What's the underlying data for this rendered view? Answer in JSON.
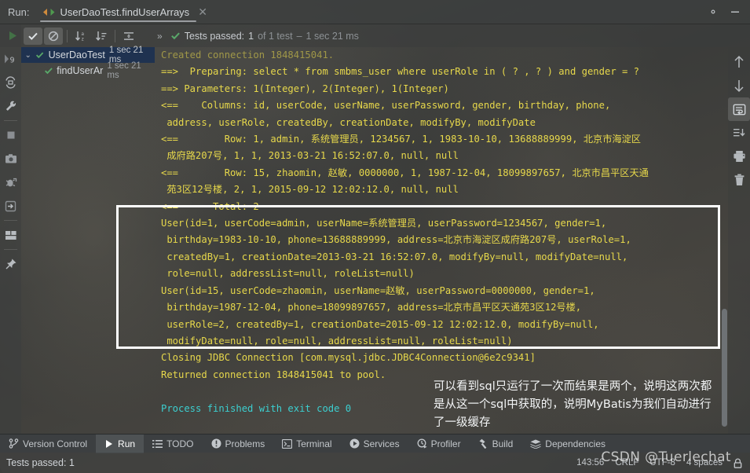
{
  "window": {
    "run_label": "Run:",
    "tab_title": "UserDaoTest.findUserArrays",
    "close_glyph": "✕",
    "settings_icon": "gear-icon",
    "minimize_icon": "minimize-icon"
  },
  "toolbar": {
    "rerun_label": "Rerun",
    "show_passed_label": "Show Passed",
    "show_ignored_label": "Show Ignored",
    "sort_alpha_label": "Sort Alphabetically",
    "sort_duration_label": "Sort by Duration",
    "expand_collapse_label": "Expand / Collapse",
    "more_glyph": "»",
    "status_prefix": "Tests passed:",
    "status_count": "1",
    "status_of": "of 1 test",
    "status_dash": "–",
    "status_time": "1 sec 21 ms"
  },
  "test_tree": {
    "rows": [
      {
        "arrow": "⌄",
        "name": "UserDaoTest",
        "time": "1 sec 21 ms",
        "selected": true,
        "indent": 0
      },
      {
        "arrow": "",
        "name": "findUserAr",
        "time": "1 sec 21 ms",
        "selected": false,
        "indent": 1
      }
    ]
  },
  "left_strip": {
    "items": [
      {
        "icon": "rerun-failed-icon",
        "label": "Rerun Failed Tests"
      },
      {
        "icon": "toggle-auto-test-icon",
        "label": "Toggle auto-test"
      },
      {
        "icon": "wrench-icon",
        "label": "Configure"
      },
      {
        "icon": "stop-icon",
        "label": "Stop"
      },
      {
        "icon": "camera-icon",
        "label": "Export Test Results"
      },
      {
        "icon": "debug-icon",
        "label": "Debug"
      },
      {
        "icon": "import-icon",
        "label": "Import Tests from File"
      },
      {
        "icon": "layout-icon",
        "label": "Layout"
      },
      {
        "icon": "pin-icon",
        "label": "Pin Tab"
      }
    ]
  },
  "right_strip": {
    "items": [
      {
        "icon": "arrow-up-icon",
        "label": "Up the Stack Trace",
        "active": false
      },
      {
        "icon": "arrow-down-icon",
        "label": "Down the Stack Trace",
        "active": false
      },
      {
        "icon": "soft-wrap-icon",
        "label": "Soft-Wrap",
        "active": true
      },
      {
        "icon": "scroll-to-end-icon",
        "label": "Scroll to End",
        "active": false
      },
      {
        "icon": "print-icon",
        "label": "Print",
        "active": false
      },
      {
        "icon": "trash-icon",
        "label": "Clear All",
        "active": false
      }
    ]
  },
  "console": {
    "lines": [
      {
        "text": "Created connection 1848415041.",
        "style": "cut"
      },
      {
        "text": "==>  Preparing: select * from smbms_user where userRole in ( ? , ? ) and gender = ?",
        "style": "yellow"
      },
      {
        "text": "==> Parameters: 1(Integer), 2(Integer), 1(Integer)",
        "style": "yellow"
      },
      {
        "text": "<==    Columns: id, userCode, userName, userPassword, gender, birthday, phone,",
        "style": "yellow"
      },
      {
        "text": " address, userRole, createdBy, creationDate, modifyBy, modifyDate",
        "style": "yellow"
      },
      {
        "text": "<==        Row: 1, admin, 系统管理员, 1234567, 1, 1983-10-10, 13688889999, 北京市海淀区",
        "style": "yellow"
      },
      {
        "text": " 成府路207号, 1, 1, 2013-03-21 16:52:07.0, null, null",
        "style": "yellow"
      },
      {
        "text": "<==        Row: 15, zhaomin, 赵敏, 0000000, 1, 1987-12-04, 18099897657, 北京市昌平区天通",
        "style": "yellow"
      },
      {
        "text": " 苑3区12号楼, 2, 1, 2015-09-12 12:02:12.0, null, null",
        "style": "yellow"
      },
      {
        "text": "<==      Total: 2",
        "style": "yellow"
      },
      {
        "text": "User(id=1, userCode=admin, userName=系统管理员, userPassword=1234567, gender=1,",
        "style": "yellow"
      },
      {
        "text": " birthday=1983-10-10, phone=13688889999, address=北京市海淀区成府路207号, userRole=1,",
        "style": "yellow"
      },
      {
        "text": " createdBy=1, creationDate=2013-03-21 16:52:07.0, modifyBy=null, modifyDate=null,",
        "style": "yellow"
      },
      {
        "text": " role=null, addressList=null, roleList=null)",
        "style": "yellow"
      },
      {
        "text": "User(id=15, userCode=zhaomin, userName=赵敏, userPassword=0000000, gender=1,",
        "style": "yellow"
      },
      {
        "text": " birthday=1987-12-04, phone=18099897657, address=北京市昌平区天通苑3区12号楼,",
        "style": "yellow"
      },
      {
        "text": " userRole=2, createdBy=1, creationDate=2015-09-12 12:02:12.0, modifyBy=null,",
        "style": "yellow"
      },
      {
        "text": " modifyDate=null, role=null, addressList=null, roleList=null)",
        "style": "yellow"
      },
      {
        "text": "Closing JDBC Connection [com.mysql.jdbc.JDBC4Connection@6e2c9341]",
        "style": "yellow"
      },
      {
        "text": "Returned connection 1848415041 to pool.",
        "style": "yellow"
      },
      {
        "text": "",
        "style": "blank"
      },
      {
        "text": "Process finished with exit code 0",
        "style": "cyan"
      }
    ]
  },
  "annotation": {
    "line1": "可以看到sql只运行了一次而结果是两个，说明这两次都",
    "line2": "是从这一个sql中获取的，说明MyBatis为我们自动进行",
    "line3": "了一级缓存",
    "box_color": "#ffffff"
  },
  "tool_window_bar": {
    "items": [
      {
        "icon": "branch-icon",
        "label": "Version Control",
        "active": false
      },
      {
        "icon": "play-icon",
        "label": "Run",
        "active": true
      },
      {
        "icon": "list-icon",
        "label": "TODO",
        "active": false
      },
      {
        "icon": "error-icon",
        "label": "Problems",
        "active": false
      },
      {
        "icon": "terminal-icon",
        "label": "Terminal",
        "active": false
      },
      {
        "icon": "services-icon",
        "label": "Services",
        "active": false
      },
      {
        "icon": "profiler-icon",
        "label": "Profiler",
        "active": false
      },
      {
        "icon": "hammer-icon",
        "label": "Build",
        "active": false
      },
      {
        "icon": "dependencies-icon",
        "label": "Dependencies",
        "active": false
      }
    ]
  },
  "status_bar": {
    "message": "Tests passed: 1",
    "caret_position": "143:56",
    "line_separator": "CRLF",
    "encoding": "UTF-8",
    "indent": "4 spaces",
    "lock_glyph": "🔒"
  },
  "watermark": {
    "text": "CSDN @Tuerlechat"
  },
  "colors": {
    "console_yellow": "#e7d84b",
    "console_cyan": "#3ccfd0",
    "selection_blue": "#1f3250",
    "pass_green": "#59a869",
    "panel": "#3c3f41"
  }
}
